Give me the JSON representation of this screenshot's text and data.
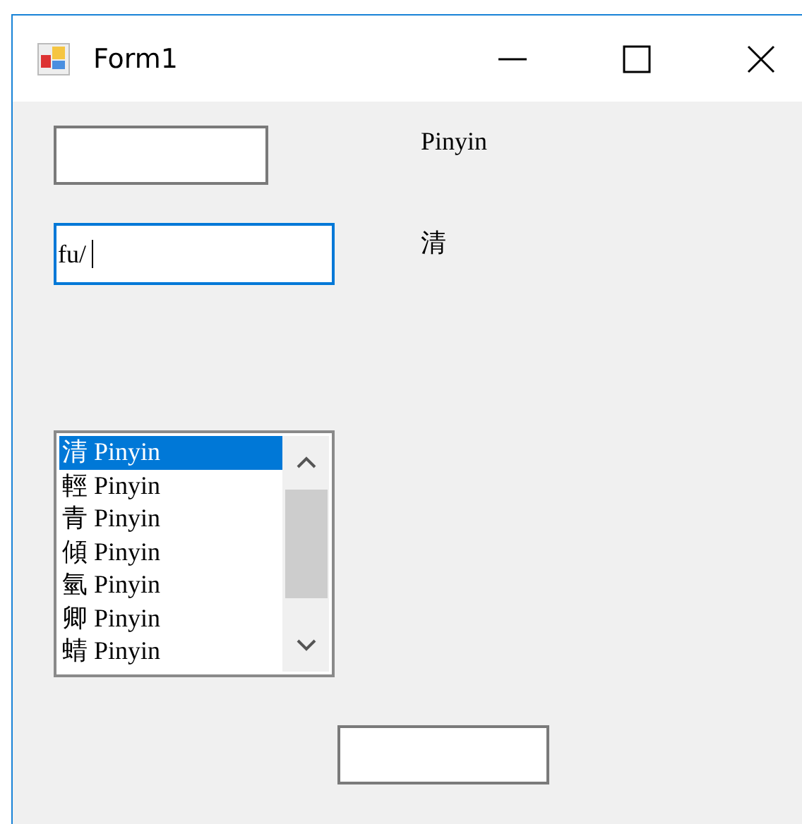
{
  "window": {
    "title": "Form1"
  },
  "label_1": "Pinyin",
  "input_2": {
    "value": "fu/",
    "focused": true
  },
  "label_2": "清",
  "list": {
    "items": [
      {
        "char": "清",
        "text": "Pinyin",
        "selected": true
      },
      {
        "char": "輕",
        "text": "Pinyin",
        "selected": false
      },
      {
        "char": "青",
        "text": "Pinyin",
        "selected": false
      },
      {
        "char": "傾",
        "text": "Pinyin",
        "selected": false
      },
      {
        "char": "氫",
        "text": "Pinyin",
        "selected": false
      },
      {
        "char": "卿",
        "text": "Pinyin",
        "selected": false
      },
      {
        "char": "蜻",
        "text": "Pinyin",
        "selected": false
      }
    ]
  }
}
